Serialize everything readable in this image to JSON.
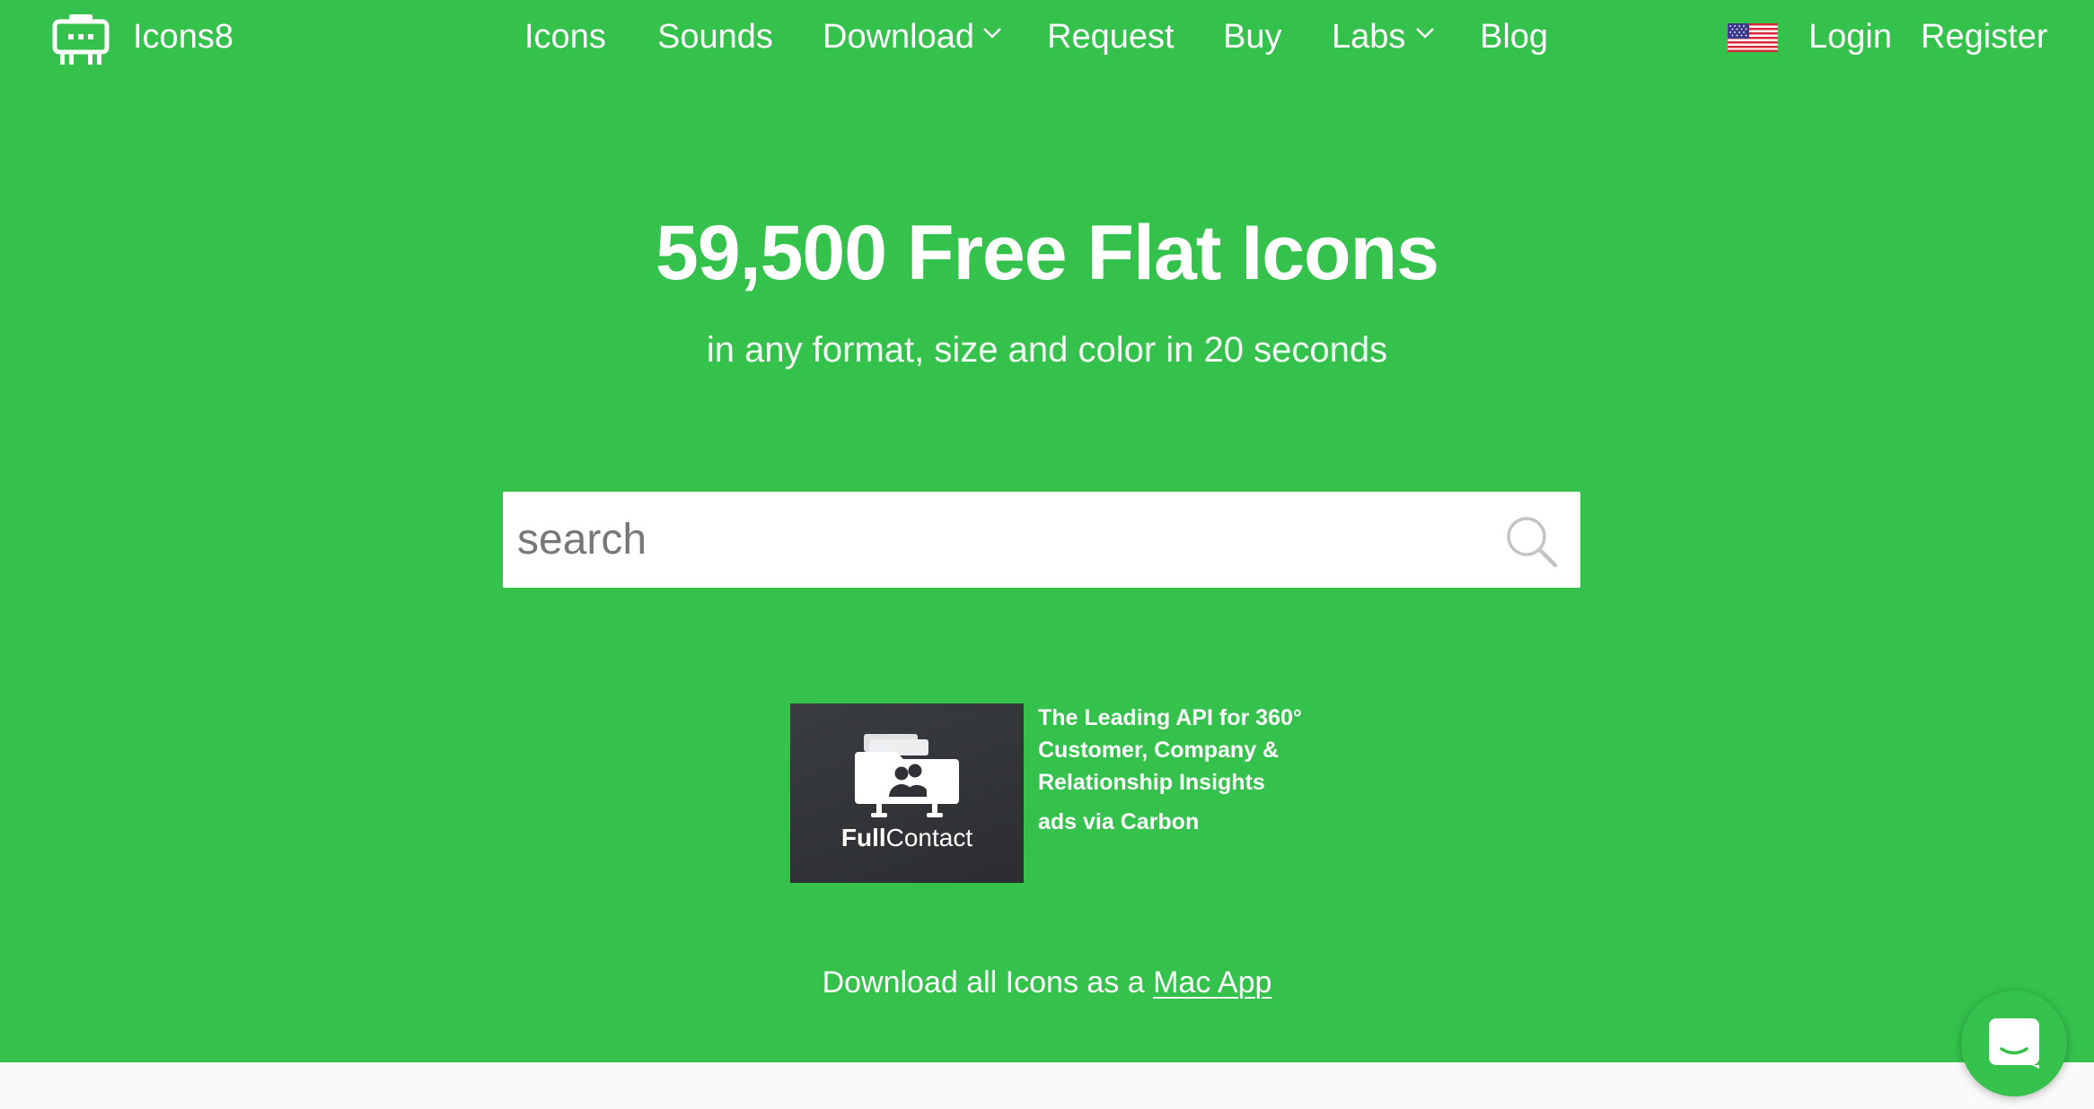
{
  "header": {
    "logo_text": "Icons8",
    "nav": {
      "icons": "Icons",
      "sounds": "Sounds",
      "download": "Download",
      "request": "Request",
      "buy": "Buy",
      "labs": "Labs",
      "blog": "Blog"
    },
    "language_flag": "us-flag-icon",
    "login": "Login",
    "register": "Register"
  },
  "hero": {
    "title": "59,500 Free Flat Icons",
    "subtitle": "in any format, size and color in 20 seconds"
  },
  "search": {
    "placeholder": "search",
    "value": ""
  },
  "ad": {
    "brand_bold": "Full",
    "brand_light": "Contact",
    "lines": [
      "The Leading API for 360°",
      "Customer, Company &",
      "Relationship Insights"
    ],
    "via": "ads via Carbon"
  },
  "mac_app": {
    "prefix": "Download all Icons as a",
    "link": "Mac App"
  },
  "colors": {
    "brand_green": "#34c24c",
    "white": "#ffffff",
    "ad_dark": "#2f3134"
  },
  "icons": {
    "logo": "icons8-robot-logo-icon",
    "dropdown": "chevron-down-icon",
    "search": "search-icon",
    "chat": "chat-icon"
  }
}
